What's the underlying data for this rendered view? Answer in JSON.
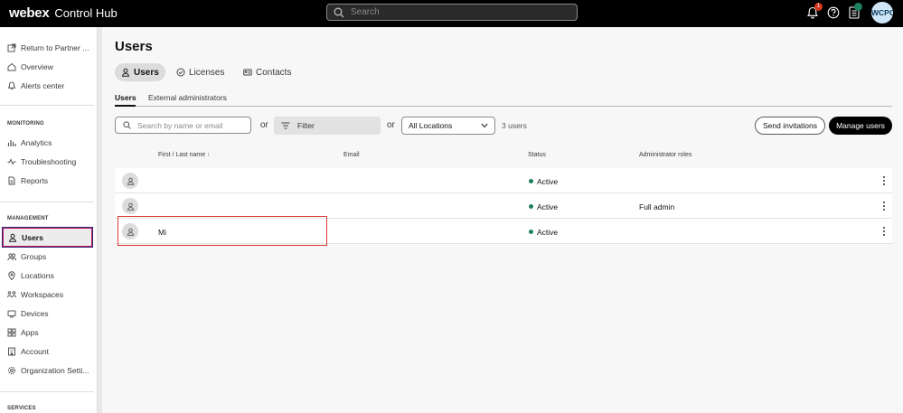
{
  "topbar": {
    "brand_logo": "webex",
    "brand_product": "Control Hub",
    "search_placeholder": "Search",
    "notification_count": "1",
    "avatar_initials": "WCPC"
  },
  "sidebar": {
    "top_items": [
      {
        "label": "Return to Partner ...",
        "icon": "external-link-icon"
      },
      {
        "label": "Overview",
        "icon": "home-icon"
      },
      {
        "label": "Alerts center",
        "icon": "bell-icon"
      }
    ],
    "monitoring_title": "MONITORING",
    "monitoring_items": [
      {
        "label": "Analytics",
        "icon": "bar-chart-icon"
      },
      {
        "label": "Troubleshooting",
        "icon": "pulse-icon"
      },
      {
        "label": "Reports",
        "icon": "document-icon"
      }
    ],
    "management_title": "MANAGEMENT",
    "management_items": [
      {
        "label": "Users",
        "icon": "user-icon",
        "active": true
      },
      {
        "label": "Groups",
        "icon": "group-icon"
      },
      {
        "label": "Locations",
        "icon": "location-pin-icon"
      },
      {
        "label": "Workspaces",
        "icon": "workspaces-icon"
      },
      {
        "label": "Devices",
        "icon": "device-icon"
      },
      {
        "label": "Apps",
        "icon": "apps-icon"
      },
      {
        "label": "Account",
        "icon": "building-icon"
      },
      {
        "label": "Organization Setti...",
        "icon": "gear-icon"
      }
    ],
    "services_title": "SERVICES"
  },
  "main": {
    "title": "Users",
    "tabs": [
      {
        "label": "Users",
        "icon": "user-icon",
        "active": true
      },
      {
        "label": "Licenses",
        "icon": "check-circle-icon"
      },
      {
        "label": "Contacts",
        "icon": "contact-card-icon"
      }
    ],
    "subtabs": [
      {
        "label": "Users",
        "active": true
      },
      {
        "label": "External administrators"
      }
    ],
    "toolbar": {
      "search_placeholder": "Search by name or email",
      "or_label": "or",
      "filter_label": "Filter",
      "location_value": "All Locations",
      "user_count": "3 users",
      "send_invitations": "Send invitations",
      "manage_users": "Manage users"
    },
    "table": {
      "columns": [
        "First / Last name",
        "Email",
        "Status",
        "Administrator roles"
      ],
      "sort_indicator": "↑",
      "rows": [
        {
          "name": "",
          "email": "",
          "status": "Active",
          "role": ""
        },
        {
          "name": "",
          "email": "",
          "status": "Active",
          "role": "Full admin"
        },
        {
          "name": "Mi",
          "email": "",
          "status": "Active",
          "role": ""
        }
      ]
    }
  },
  "colors": {
    "topbar": "#000000",
    "active_status": "#1d805f",
    "notification_badge": "#d4371c",
    "highlight_box": "#d93a35"
  }
}
